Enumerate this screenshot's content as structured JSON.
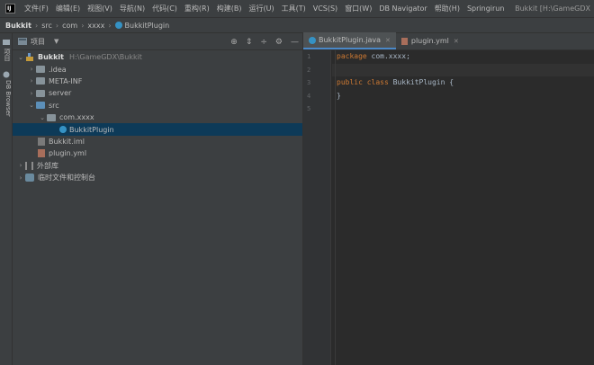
{
  "menu": {
    "items": [
      "文件(F)",
      "编辑(E)",
      "视图(V)",
      "导航(N)",
      "代码(C)",
      "重构(R)",
      "构建(B)",
      "运行(U)",
      "工具(T)",
      "VCS(S)",
      "窗口(W)",
      "DB Navigator",
      "帮助(H)",
      "Springirun"
    ],
    "window_title": "Bukkit [H:\\GameGDX"
  },
  "breadcrumb": [
    "Bukkit",
    "src",
    "com",
    "xxxx",
    "BukkitPlugin"
  ],
  "left_strip": {
    "project_label": "项目",
    "db_label": "DB Browser"
  },
  "project": {
    "title": "项目",
    "tree": {
      "root_name": "Bukkit",
      "root_path": "H:\\GameGDX\\Bukkit",
      "idea": ".idea",
      "meta": "META-INF",
      "server": "server",
      "src": "src",
      "pkg": "com.xxxx",
      "plugin_class": "BukkitPlugin",
      "iml": "Bukkit.iml",
      "yml": "plugin.yml",
      "ext_libs": "外部库",
      "scratches": "临时文件和控制台"
    }
  },
  "editor": {
    "tabs": [
      "BukkitPlugin.java",
      "plugin.yml"
    ],
    "active_tab": 0,
    "line_numbers": [
      "1",
      "2",
      "3",
      "4",
      "5"
    ],
    "lines": {
      "l1_kw": "package",
      "l1_rest": " com.xxxx;",
      "l3_kw1": "public",
      "l3_kw2": "class",
      "l3_rest": " BukkitPlugin {",
      "l4": "}"
    }
  },
  "colors": {
    "background": "#2b2b2b",
    "panel": "#3c3f41",
    "selection": "#0d3a58",
    "keyword": "#cc7832",
    "text": "#a9b7c6",
    "class_icon": "#3592c4"
  }
}
